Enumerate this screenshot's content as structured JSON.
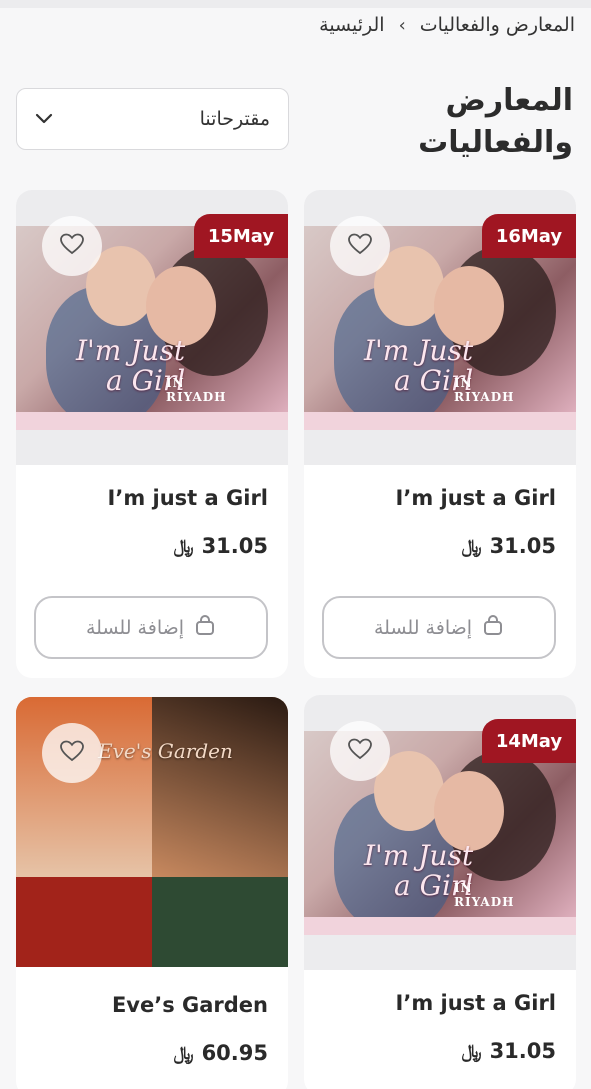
{
  "breadcrumb": {
    "home": "الرئيسية",
    "separator": "›",
    "current": "المعارض والفعاليات"
  },
  "page": {
    "title": "المعارض والفعاليات"
  },
  "sort": {
    "selected": "مقترحاتنا",
    "icon": "chevron-down-icon"
  },
  "cart_label": "إضافة للسلة",
  "currency_symbol": "﷼",
  "colors": {
    "badge": "#a01622",
    "background": "#f7f7f8",
    "card": "#ffffff"
  },
  "products": [
    {
      "badge": "16May",
      "name": "I’m just a Girl",
      "price": "31.05",
      "poster_text_1": "I'm Just",
      "poster_text_2": "a Girl",
      "poster_city_1": "IN",
      "poster_city_2": "RIYADH"
    },
    {
      "badge": "15May",
      "name": "I’m just a Girl",
      "price": "31.05",
      "poster_text_1": "I'm Just",
      "poster_text_2": "a Girl",
      "poster_city_1": "IN",
      "poster_city_2": "RIYADH"
    },
    {
      "badge": "14May",
      "name": "I’m just a Girl",
      "price": "31.05",
      "poster_text_1": "I'm Just",
      "poster_text_2": "a Girl",
      "poster_city_1": "IN",
      "poster_city_2": "RIYADH"
    },
    {
      "badge": "",
      "name": "Eve’s Garden",
      "price": "60.95",
      "poster_text_1": "Eve's Garden"
    }
  ]
}
